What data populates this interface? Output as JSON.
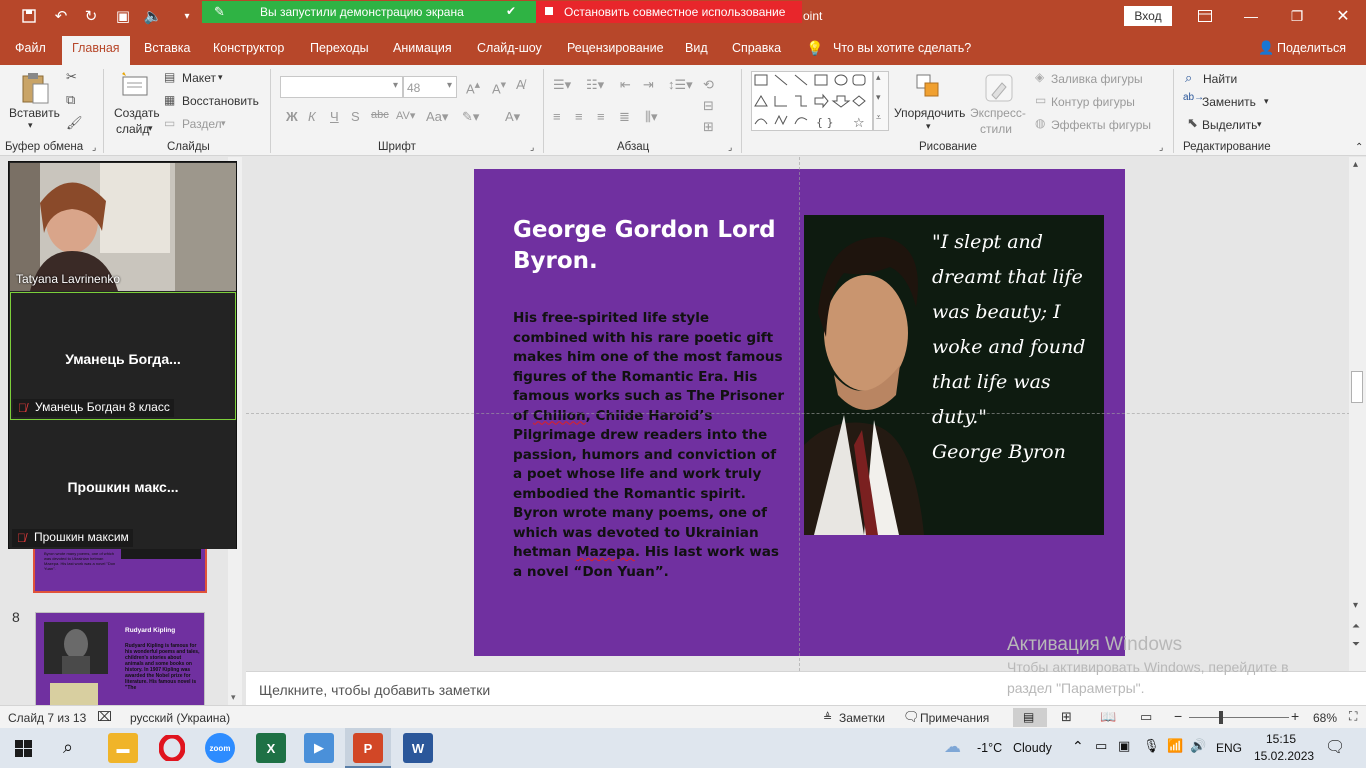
{
  "titlebar": {
    "share_status": "Вы запустили демонстрацию экрана",
    "stop_share": "Остановить совместное использование",
    "app_partial": "oint",
    "login": "Вход"
  },
  "tabs": [
    "Файл",
    "Главная",
    "Вставка",
    "Конструктор",
    "Переходы",
    "Анимация",
    "Слайд-шоу",
    "Рецензирование",
    "Вид",
    "Справка",
    "Что вы хотите сделать?"
  ],
  "share_label": "Поделиться",
  "ribbon": {
    "groups": {
      "clipboard": "Буфер обмена",
      "slides": "Слайды",
      "font": "Шрифт",
      "paragraph": "Абзац",
      "drawing": "Рисование",
      "editing": "Редактирование"
    },
    "paste": "Вставить",
    "new_slide_1": "Создать",
    "new_slide_2": "слайд",
    "layout": "Макет",
    "reset": "Восстановить",
    "section": "Раздел",
    "font_size": "48",
    "arrange": "Упорядочить",
    "quick_styles_1": "Экспресс-",
    "quick_styles_2": "стили",
    "shape_fill": "Заливка фигуры",
    "shape_outline": "Контур фигуры",
    "shape_effects": "Эффекты фигуры",
    "find": "Найти",
    "replace": "Заменить",
    "select": "Выделить"
  },
  "participants": [
    {
      "name": "Tatyana Lavrinenko"
    },
    {
      "display": "Уманець  Богда...",
      "name": "Уманець Богдан 8 класс"
    },
    {
      "display": "Прошкин  макс...",
      "name": "Прошкин максим"
    }
  ],
  "thumbnails": {
    "slide8_number": "8",
    "slide8_title": "Rudyard Kipling",
    "slide8_text": "Rudyard Kipling is famous for his wonderful poems and tales, children's stories about animals and some books on history. In 1907 Kipling was awarded the Nobel prize for literature. His famous novel is \"The",
    "slide7_fragment": "Byron wrote many poems, one of which was devoted to Ukrainian hetman Mazepa. His last work was a novel \"Don Yuan\"."
  },
  "slide": {
    "title": "George Gordon Lord Byron.",
    "body": {
      "p1": "His free-spirited life style combined with his rare poetic gift makes him one of the most famous figures of the Romantic Era. His famous works such as The Prisoner of ",
      "w1": "Chilion",
      "p2": ", Childe Haroid’s Pilgrimage  drew readers into the passion, humors and conviction of a poet whose life and work truly embodied the Romantic spirit. Byron wrote many poems, one of which was devoted to Ukrainian hetman ",
      "w2": "Mazepa",
      "p3": ". His last work was a novel “Don Yuan”."
    },
    "quote": "\"I slept and dreamt that life was beauty; I woke and found that life was duty.\"",
    "quote_author": "George Byron"
  },
  "notes_placeholder": "Щелкните, чтобы добавить заметки",
  "activation": {
    "title": "Активация Windows",
    "subtitle": "Чтобы активировать Windows, перейдите в раздел \"Параметры\"."
  },
  "status": {
    "slide": "Слайд 7 из 13",
    "language": "русский (Украина)",
    "notes": "Заметки",
    "comments": "Примечания",
    "zoom": "68%",
    "zoom_level": 0.68
  },
  "taskbar": {
    "weather_temp": "-1°C",
    "weather_text": "Cloudy",
    "lang": "ENG",
    "time": "15:15",
    "date": "15.02.2023",
    "zoom_app": "zoom"
  },
  "colors": {
    "accent": "#b7472a",
    "slide_bg": "#7030a0",
    "share_green": "#2fb344",
    "share_red": "#e8262b"
  }
}
